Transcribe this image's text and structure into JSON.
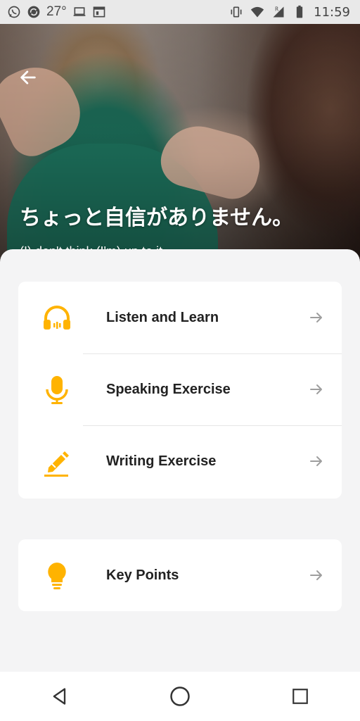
{
  "status_bar": {
    "temperature": "27°",
    "time": "11:59",
    "left_icons": [
      "whatsapp-icon",
      "sync-icon",
      "laptop-icon",
      "calendar-window-icon"
    ],
    "right_icons": [
      "vibrate-icon",
      "wifi-icon",
      "signal-roaming-icon",
      "battery-icon"
    ]
  },
  "hero": {
    "title": "ちょっと自信がありません。",
    "subtitle": "(I) don't think (I'm) up to it."
  },
  "menu": {
    "items": [
      {
        "label": "Listen and Learn",
        "icon": "headphones-icon"
      },
      {
        "label": "Speaking Exercise",
        "icon": "microphone-icon"
      },
      {
        "label": "Writing Exercise",
        "icon": "pencil-icon"
      }
    ],
    "key_points": {
      "label": "Key Points",
      "icon": "lightbulb-icon"
    }
  },
  "colors": {
    "accent": "#FFB300",
    "background": "#F4F4F5",
    "card": "#FFFFFF",
    "text": "#222222",
    "arrow": "#9E9E9E"
  },
  "nav": {
    "icons": [
      "back-triangle-icon",
      "home-circle-icon",
      "recents-square-icon"
    ]
  }
}
